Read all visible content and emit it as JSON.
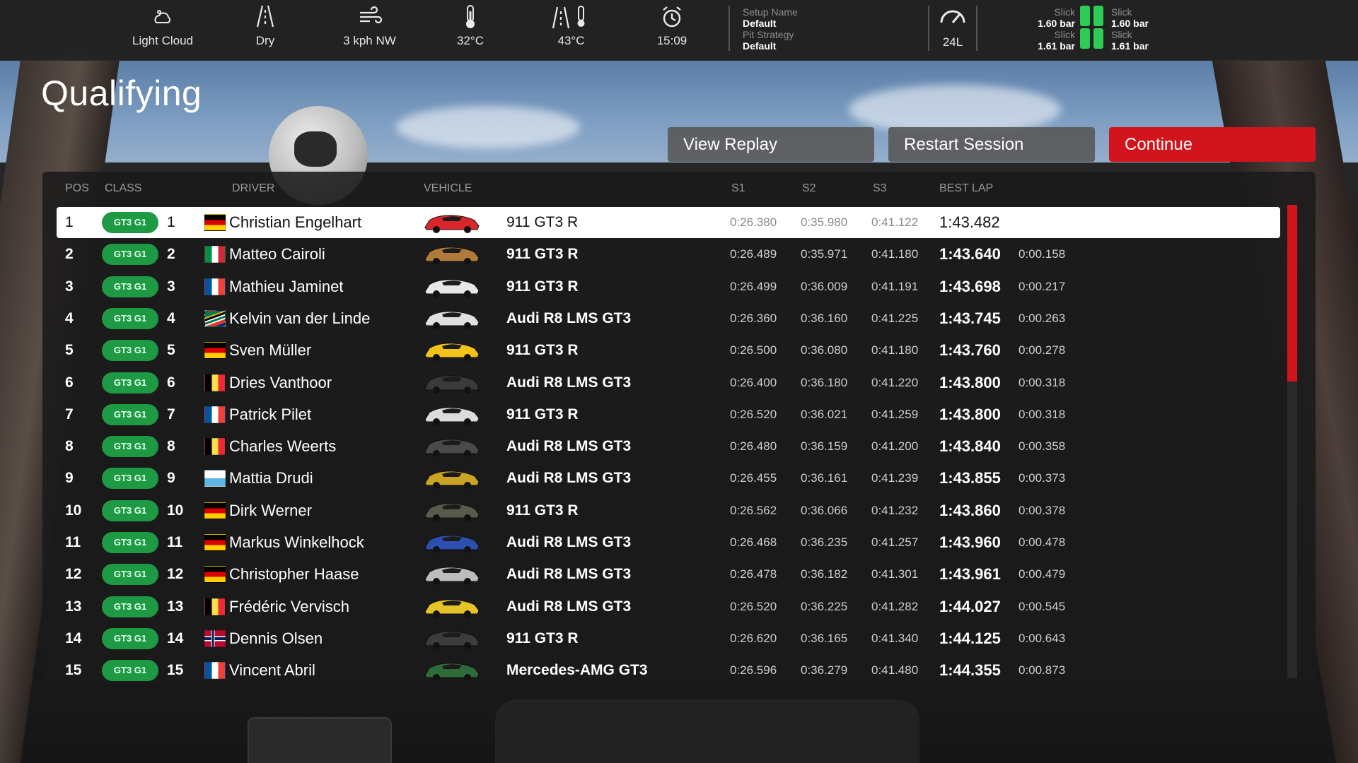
{
  "weather": {
    "sky": {
      "label": "Light Cloud",
      "icon": "cloud-icon"
    },
    "track": {
      "label": "Dry",
      "icon": "road-icon"
    },
    "wind": {
      "label": "3 kph  NW",
      "icon": "wind-icon"
    },
    "air_temp": {
      "label": "32°C",
      "icon": "thermometer-icon"
    },
    "track_temp": {
      "label": "43°C",
      "icon": "track-temp-icon"
    },
    "time": {
      "label": "15:09",
      "icon": "alarm-clock-icon"
    }
  },
  "setup": {
    "setup_name_label": "Setup Name",
    "setup_name_value": "Default",
    "pit_strategy_label": "Pit Strategy",
    "pit_strategy_value": "Default"
  },
  "fuel": {
    "value": "24L",
    "icon": "fuel-gauge-icon"
  },
  "tyres": {
    "fl": {
      "compound": "Slick",
      "pressure": "1.60 bar"
    },
    "fr": {
      "compound": "Slick",
      "pressure": "1.60 bar"
    },
    "rl": {
      "compound": "Slick",
      "pressure": "1.61 bar"
    },
    "rr": {
      "compound": "Slick",
      "pressure": "1.61 bar"
    },
    "status_color": "#2ecc55"
  },
  "page": {
    "title": "Qualifying"
  },
  "buttons": {
    "view_replay": "View Replay",
    "restart_session": "Restart Session",
    "continue": "Continue"
  },
  "colors": {
    "accent": "#d2141c",
    "class_badge": "#1f9a44"
  },
  "columns": {
    "pos": "POS",
    "class": "CLASS",
    "driver": "DRIVER",
    "vehicle": "VEHICLE",
    "s1": "S1",
    "s2": "S2",
    "s3": "S3",
    "best_lap": "BEST LAP"
  },
  "results": [
    {
      "pos": "1",
      "class": "GT3 G1",
      "number": "1",
      "flag": "germany",
      "driver": "Christian Engelhart",
      "car_livery": "#d8262a",
      "vehicle": "911 GT3 R",
      "s1": "0:26.380",
      "s2": "0:35.980",
      "s3": "0:41.122",
      "best": "1:43.482",
      "gap": ""
    },
    {
      "pos": "2",
      "class": "GT3 G1",
      "number": "2",
      "flag": "italy",
      "driver": "Matteo Cairoli",
      "car_livery": "#b07a3a",
      "vehicle": "911 GT3 R",
      "s1": "0:26.489",
      "s2": "0:35.971",
      "s3": "0:41.180",
      "best": "1:43.640",
      "gap": "0:00.158"
    },
    {
      "pos": "3",
      "class": "GT3 G1",
      "number": "3",
      "flag": "france",
      "driver": "Mathieu Jaminet",
      "car_livery": "#e8e8e8",
      "vehicle": "911 GT3 R",
      "s1": "0:26.499",
      "s2": "0:36.009",
      "s3": "0:41.191",
      "best": "1:43.698",
      "gap": "0:00.217"
    },
    {
      "pos": "4",
      "class": "GT3 G1",
      "number": "4",
      "flag": "south-africa",
      "driver": "Kelvin van der Linde",
      "car_livery": "#e0e0e0",
      "vehicle": "Audi R8 LMS GT3",
      "s1": "0:26.360",
      "s2": "0:36.160",
      "s3": "0:41.225",
      "best": "1:43.745",
      "gap": "0:00.263"
    },
    {
      "pos": "5",
      "class": "GT3 G1",
      "number": "5",
      "flag": "germany",
      "driver": "Sven Müller",
      "car_livery": "#f2c21a",
      "vehicle": "911 GT3 R",
      "s1": "0:26.500",
      "s2": "0:36.080",
      "s3": "0:41.180",
      "best": "1:43.760",
      "gap": "0:00.278"
    },
    {
      "pos": "6",
      "class": "GT3 G1",
      "number": "6",
      "flag": "belgium",
      "driver": "Dries Vanthoor",
      "car_livery": "#3a3a3a",
      "vehicle": "Audi R8 LMS GT3",
      "s1": "0:26.400",
      "s2": "0:36.180",
      "s3": "0:41.220",
      "best": "1:43.800",
      "gap": "0:00.318"
    },
    {
      "pos": "7",
      "class": "GT3 G1",
      "number": "7",
      "flag": "france",
      "driver": "Patrick Pilet",
      "car_livery": "#dcdcdc",
      "vehicle": "911 GT3 R",
      "s1": "0:26.520",
      "s2": "0:36.021",
      "s3": "0:41.259",
      "best": "1:43.800",
      "gap": "0:00.318"
    },
    {
      "pos": "8",
      "class": "GT3 G1",
      "number": "8",
      "flag": "belgium",
      "driver": "Charles Weerts",
      "car_livery": "#4a4a4a",
      "vehicle": "Audi R8 LMS GT3",
      "s1": "0:26.480",
      "s2": "0:36.159",
      "s3": "0:41.200",
      "best": "1:43.840",
      "gap": "0:00.358"
    },
    {
      "pos": "9",
      "class": "GT3 G1",
      "number": "9",
      "flag": "san-marino",
      "driver": "Mattia Drudi",
      "car_livery": "#c9a326",
      "vehicle": "Audi R8 LMS GT3",
      "s1": "0:26.455",
      "s2": "0:36.161",
      "s3": "0:41.239",
      "best": "1:43.855",
      "gap": "0:00.373"
    },
    {
      "pos": "10",
      "class": "GT3 G1",
      "number": "10",
      "flag": "germany",
      "driver": "Dirk Werner",
      "car_livery": "#5a5a4a",
      "vehicle": "911 GT3 R",
      "s1": "0:26.562",
      "s2": "0:36.066",
      "s3": "0:41.232",
      "best": "1:43.860",
      "gap": "0:00.378"
    },
    {
      "pos": "11",
      "class": "GT3 G1",
      "number": "11",
      "flag": "germany",
      "driver": "Markus Winkelhock",
      "car_livery": "#2d4fb0",
      "vehicle": "Audi R8 LMS GT3",
      "s1": "0:26.468",
      "s2": "0:36.235",
      "s3": "0:41.257",
      "best": "1:43.960",
      "gap": "0:00.478"
    },
    {
      "pos": "12",
      "class": "GT3 G1",
      "number": "12",
      "flag": "germany",
      "driver": "Christopher Haase",
      "car_livery": "#bdbdbd",
      "vehicle": "Audi R8 LMS GT3",
      "s1": "0:26.478",
      "s2": "0:36.182",
      "s3": "0:41.301",
      "best": "1:43.961",
      "gap": "0:00.479"
    },
    {
      "pos": "13",
      "class": "GT3 G1",
      "number": "13",
      "flag": "belgium",
      "driver": "Frédéric Vervisch",
      "car_livery": "#e6c229",
      "vehicle": "Audi R8 LMS GT3",
      "s1": "0:26.520",
      "s2": "0:36.225",
      "s3": "0:41.282",
      "best": "1:44.027",
      "gap": "0:00.545"
    },
    {
      "pos": "14",
      "class": "GT3 G1",
      "number": "14",
      "flag": "norway",
      "driver": "Dennis Olsen",
      "car_livery": "#3c3c3c",
      "vehicle": "911 GT3 R",
      "s1": "0:26.620",
      "s2": "0:36.165",
      "s3": "0:41.340",
      "best": "1:44.125",
      "gap": "0:00.643"
    },
    {
      "pos": "15",
      "class": "GT3 G1",
      "number": "15",
      "flag": "france",
      "driver": "Vincent Abril",
      "car_livery": "#2f6b3a",
      "vehicle": "Mercedes-AMG GT3",
      "s1": "0:26.596",
      "s2": "0:36.279",
      "s3": "0:41.480",
      "best": "1:44.355",
      "gap": "0:00.873"
    }
  ],
  "selected_row": 0
}
